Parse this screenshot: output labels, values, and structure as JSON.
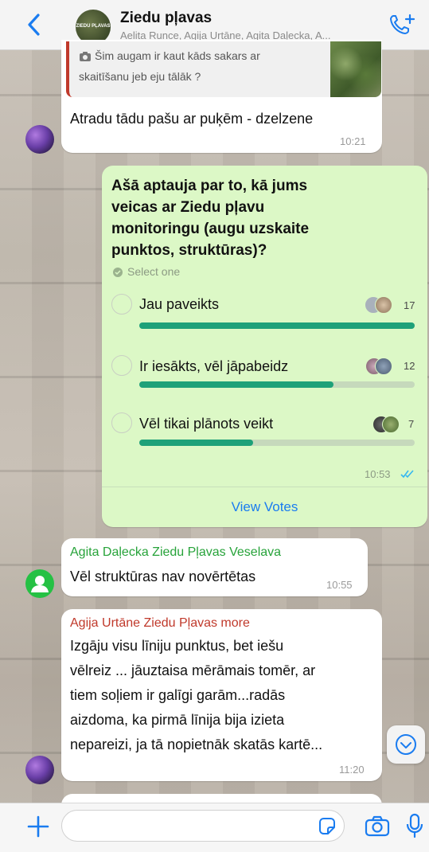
{
  "header": {
    "title": "Ziedu pļavas",
    "subtitle": "Aelita Runce, Agija Urtāne, Agita Daļecka, A...",
    "avatar_text": "ZIEDU PĻAVAS"
  },
  "messages": [
    {
      "quote_text": "Šim augam ir kaut kāds sakars ar skaitīšanu jeb eju tālāk ?",
      "quote_line1": "Šim augam ir kaut kāds sakars ar",
      "quote_line2": "skaitīšanu jeb eju tālāk ?",
      "text": "Atradu tādu pašu ar puķēm - dzelzene",
      "time": "10:21"
    }
  ],
  "poll": {
    "question_lines": [
      "Ašā aptauja par to, kā jums",
      "veicas ar Ziedu pļavu",
      "monitoringu (augu uzskaite",
      "punktos, struktūras)?"
    ],
    "select_hint": "Select one",
    "options": [
      {
        "label": "Jau paveikts",
        "votes": "17",
        "fraction": 1.0
      },
      {
        "label": "Ir iesākts, vēl jāpabeidz",
        "votes": "12",
        "fraction": 0.706
      },
      {
        "label": "Vēl tikai plānots veikt",
        "votes": "7",
        "fraction": 0.412
      }
    ],
    "time": "10:53",
    "view_votes": "View Votes"
  },
  "msg2": {
    "sender": "Agita Daļecka Ziedu Pļavas Veselava",
    "text": "Vēl struktūras  nav novērtētas",
    "time": "10:55"
  },
  "msg3": {
    "sender": "Agija Urtāne Ziedu Pļavas more",
    "lines": [
      "Izgāju visu līniju punktus, bet iešu",
      "vēlreiz ... jāuztaisa mērāmais tomēr, ar",
      "tiem soļiem ir galīgi garām...radās",
      "aizdoma, ka pirmā līnija bija izieta",
      "nepareizi, ja tā nopietnāk skatās kartē..."
    ],
    "time": "11:20"
  },
  "colors": {
    "accent_blue": "#1a7cf0",
    "outgoing_bubble": "#dcf8c6",
    "poll_bar": "#1ea179",
    "sender_green": "#27a33a",
    "sender_red": "#c0392b"
  },
  "icons": [
    "back-chevron-icon",
    "add-call-icon",
    "camera-icon",
    "plus-icon",
    "sticker-icon",
    "microphone-icon",
    "chevron-down-icon",
    "double-check-icon"
  ]
}
